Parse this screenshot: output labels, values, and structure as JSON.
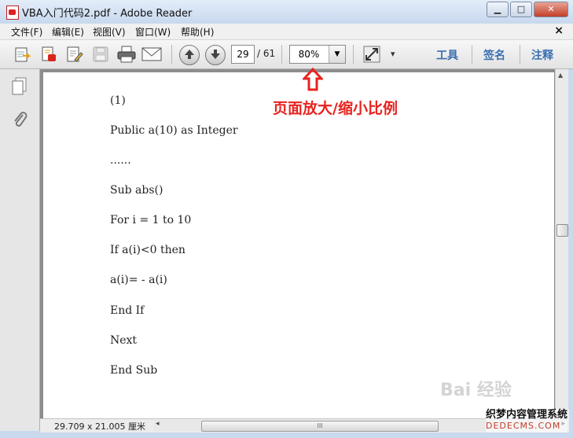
{
  "window": {
    "title": "VBA入门代码2.pdf - Adobe Reader"
  },
  "window_buttons": {
    "minimize": "▁",
    "maximize": "□",
    "close": "✕"
  },
  "menubar": {
    "items": [
      "文件(F)",
      "编辑(E)",
      "视图(V)",
      "窗口(W)",
      "帮助(H)"
    ],
    "close": "×"
  },
  "toolbar": {
    "current_page": "29",
    "total_pages": "/ 61",
    "zoom": "80%",
    "zoom_dropdown": "▼",
    "expand_dropdown": "▾",
    "tools": "工具",
    "sign": "签名",
    "comment": "注释",
    "icons": [
      "open-icon",
      "create-pdf-icon",
      "edit-icon",
      "save-icon",
      "print-icon",
      "email-icon",
      "prev-page-icon",
      "next-page-icon",
      "fit-window-icon"
    ]
  },
  "annotation": {
    "text": "页面放大/缩小比例",
    "color": "#e8231f"
  },
  "document": {
    "lines": [
      "(1)",
      "Public a(10) as Integer",
      "......",
      "Sub abs()",
      "For i = 1 to 10",
      "If a(i)<0 then",
      "a(i)= - a(i)",
      "End If",
      "Next",
      "End Sub"
    ]
  },
  "statusbar": {
    "page_size": "29.709 x 21.005 厘米",
    "scroll_grip": "III"
  },
  "watermark": {
    "logo_text": "Bai 经验",
    "site_name": "织梦内容管理系统",
    "site_url": "DEDECMS.COM"
  },
  "colors": {
    "link": "#3a6fb0",
    "title_bg": "#c7d8ee",
    "doc_bg": "#8d8d8d"
  }
}
